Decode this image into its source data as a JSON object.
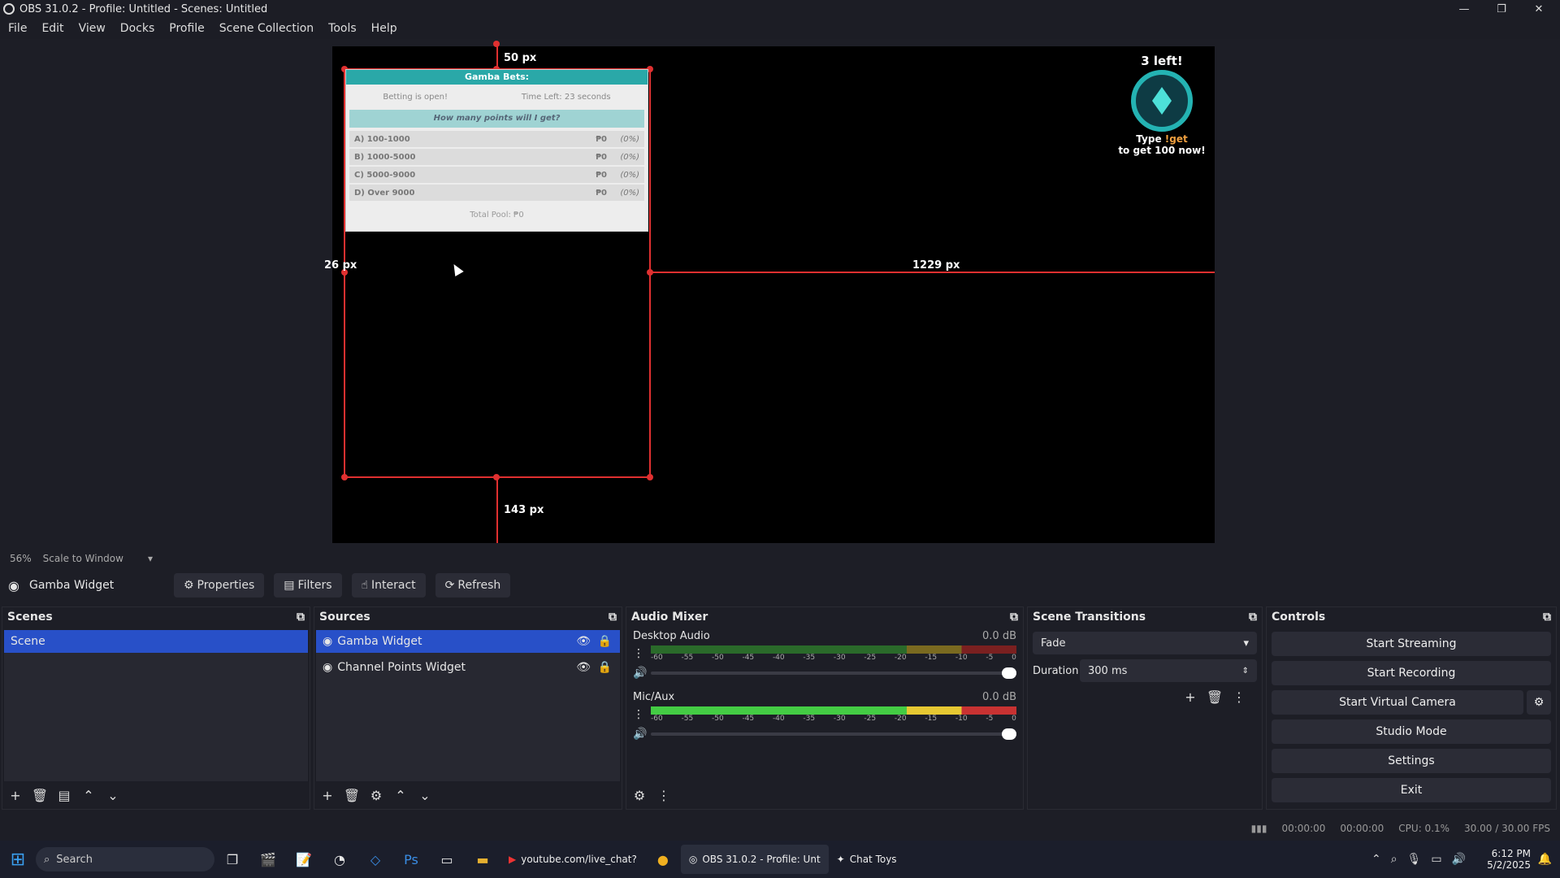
{
  "window": {
    "title": "OBS 31.0.2 - Profile: Untitled - Scenes: Untitled",
    "min": "—",
    "max": "❐",
    "close": "✕"
  },
  "menu": [
    "File",
    "Edit",
    "View",
    "Docks",
    "Profile",
    "Scene Collection",
    "Tools",
    "Help"
  ],
  "preview": {
    "dim_top": "50 px",
    "dim_left": "26 px",
    "dim_right": "1229 px",
    "dim_bottom": "143 px",
    "zoom": "56%",
    "scale_mode": "Scale to Window"
  },
  "gamba": {
    "header": "Gamba Bets:",
    "status": "Betting is open!",
    "time": "Time Left: 23 seconds",
    "question": "How many points will I get?",
    "options": [
      {
        "label": "A) 100-1000",
        "points": "₱0",
        "pct": "(0%)"
      },
      {
        "label": "B) 1000-5000",
        "points": "₱0",
        "pct": "(0%)"
      },
      {
        "label": "C) 5000-9000",
        "points": "₱0",
        "pct": "(0%)"
      },
      {
        "label": "D) Over 9000",
        "points": "₱0",
        "pct": "(0%)"
      }
    ],
    "pool": "Total Pool: ₱0"
  },
  "channel_points": {
    "left": "3 left!",
    "type_pre": "Type",
    "command": "!get",
    "cta": "to get 100 now!"
  },
  "source_toolbar": {
    "selected_source": "Gamba Widget",
    "properties": "Properties",
    "filters": "Filters",
    "interact": "Interact",
    "refresh": "Refresh"
  },
  "scenes": {
    "title": "Scenes",
    "items": [
      "Scene"
    ]
  },
  "sources": {
    "title": "Sources",
    "items": [
      "Gamba Widget",
      "Channel Points Widget"
    ]
  },
  "audio": {
    "title": "Audio Mixer",
    "channels": [
      {
        "name": "Desktop Audio",
        "db": "0.0 dB",
        "volume": 1.0
      },
      {
        "name": "Mic/Aux",
        "db": "0.0 dB",
        "volume": 1.0
      }
    ],
    "ticks": [
      "-60",
      "-55",
      "-50",
      "-45",
      "-40",
      "-35",
      "-30",
      "-25",
      "-20",
      "-15",
      "-10",
      "-5",
      "0"
    ]
  },
  "transitions": {
    "title": "Scene Transitions",
    "selected": "Fade",
    "duration_label": "Duration",
    "duration": "300 ms"
  },
  "controls": {
    "title": "Controls",
    "start_streaming": "Start Streaming",
    "start_recording": "Start Recording",
    "start_virtual_camera": "Start Virtual Camera",
    "studio_mode": "Studio Mode",
    "settings": "Settings",
    "exit": "Exit"
  },
  "status": {
    "stream_time": "00:00:00",
    "record_time": "00:00:00",
    "cpu": "CPU: 0.1%",
    "fps": "30.00 / 30.00 FPS"
  },
  "taskbar": {
    "search": "Search",
    "youtube": "youtube.com/live_chat?",
    "obs": "OBS 31.0.2 - Profile: Unt",
    "chattoys": "Chat Toys",
    "time": "6:12 PM",
    "date": "5/2/2025"
  }
}
